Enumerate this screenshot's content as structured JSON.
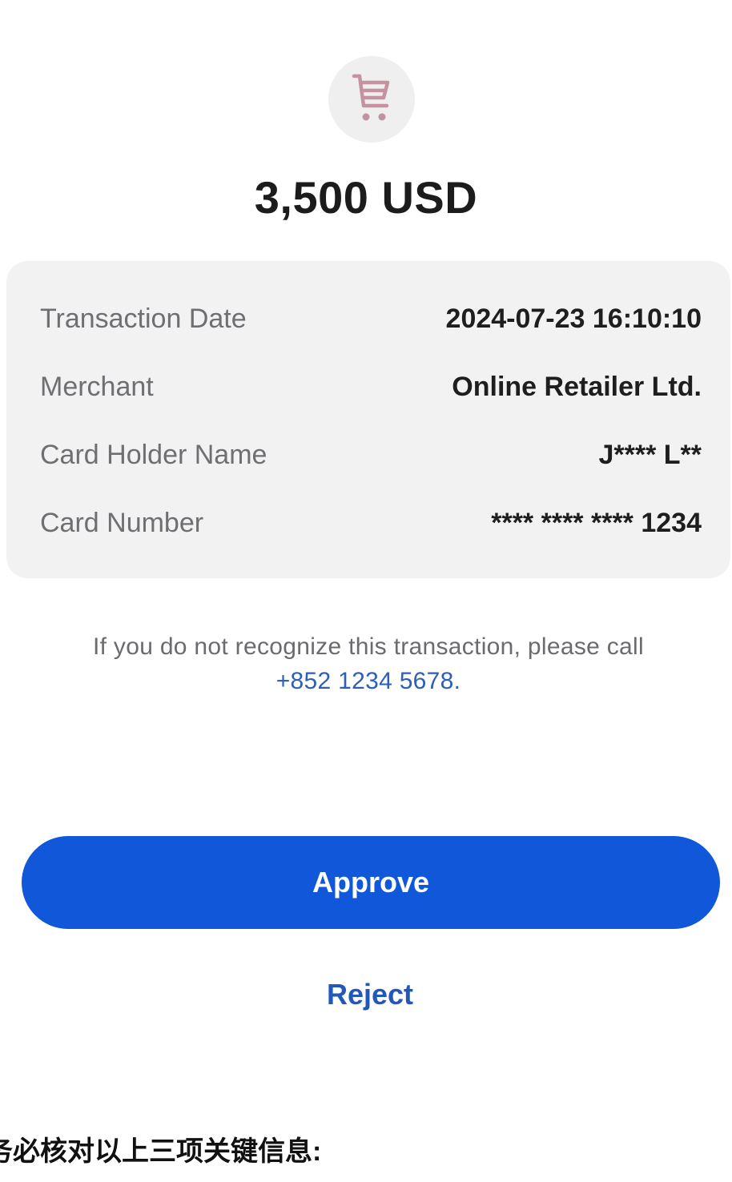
{
  "transaction": {
    "icon": "shopping-cart-icon",
    "amount": "3,500 USD"
  },
  "details": {
    "rows": [
      {
        "label": "Transaction Date",
        "value": "2024-07-23 16:10:10"
      },
      {
        "label": "Merchant",
        "value": "Online Retailer Ltd."
      },
      {
        "label": "Card Holder Name",
        "value": "J**** L**"
      },
      {
        "label": "Card Number",
        "value": "**** **** **** 1234"
      }
    ]
  },
  "notice": {
    "text": "If you do not recognize this transaction, please call",
    "phone": "+852 1234 5678",
    "suffix": "."
  },
  "actions": {
    "approve_label": "Approve",
    "reject_label": "Reject"
  },
  "caption": {
    "text": "务必核对以上三项关键信息:"
  },
  "colors": {
    "primary": "#1157d9",
    "link": "#2458b8",
    "card_bg": "#f2f2f3"
  }
}
